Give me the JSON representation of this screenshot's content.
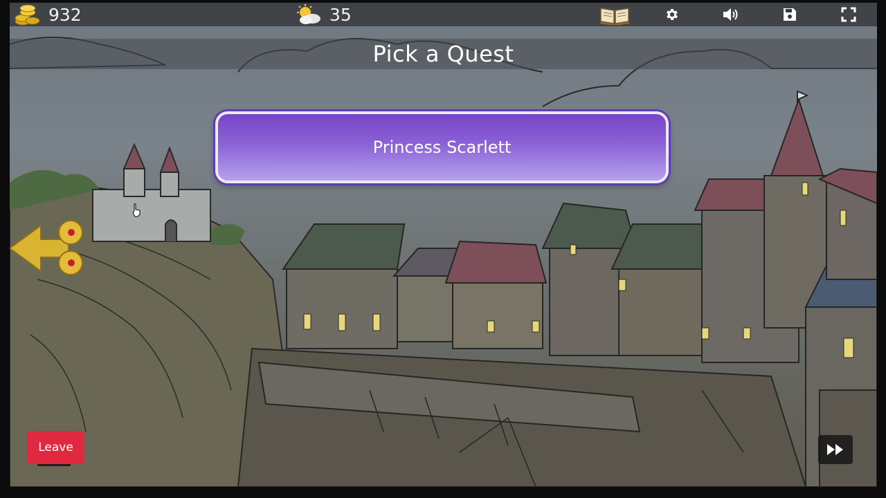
{
  "hud": {
    "gold": "932",
    "day": "35",
    "icons": {
      "gold": "gold-coins-icon",
      "weather": "sun-cloud-icon",
      "journal": "open-book-icon",
      "settings": "gear-icon",
      "sound": "speaker-icon",
      "save": "floppy-disk-icon",
      "fullscreen": "fullscreen-icon"
    }
  },
  "title": "Pick a Quest",
  "quests": [
    {
      "label": "Princess Scarlett"
    }
  ],
  "leave_label": "Leave",
  "colors": {
    "quest_button": "#8b62d6",
    "leave_button": "#e0293f",
    "hud_background": "#373a3e"
  }
}
